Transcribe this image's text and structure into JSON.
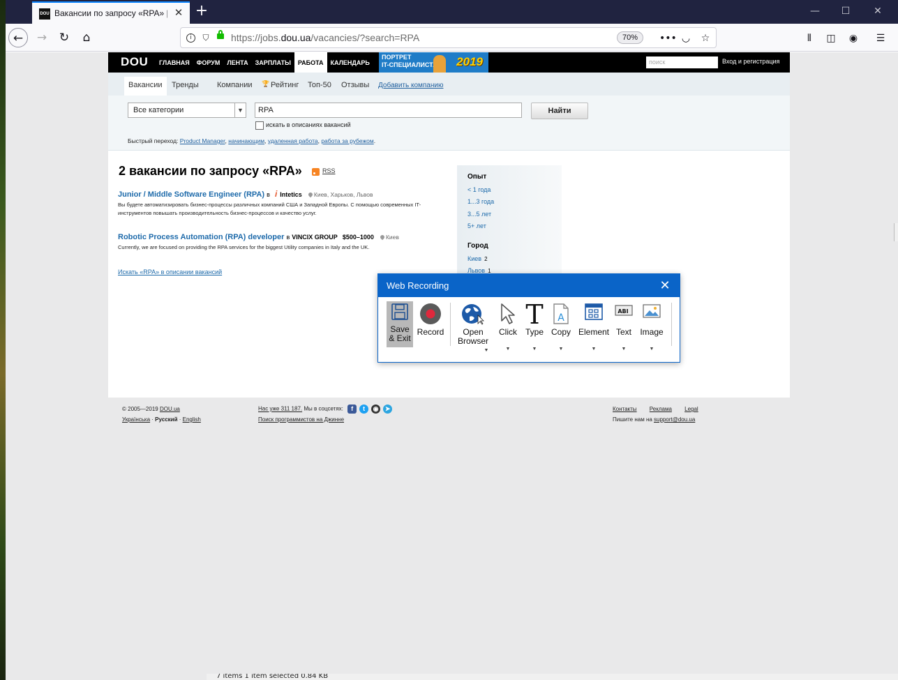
{
  "browser": {
    "tab_title": "Вакансии по запросу «RPA» | D",
    "favicon_text": "DOU",
    "url_prefix": "https://jobs.",
    "url_domain": "dou.ua",
    "url_path": "/vacancies/?search=RPA",
    "zoom": "70%"
  },
  "site": {
    "logo": "DOU",
    "nav": [
      "ГЛАВНАЯ",
      "ФОРУМ",
      "ЛЕНТА",
      "ЗАРПЛАТЫ",
      "РАБОТА",
      "КАЛЕНДАРЬ"
    ],
    "banner_text_line1": "ПОРТРЕТ",
    "banner_text_line2": "IT-СПЕЦИАЛИСТА",
    "banner_year": "2019",
    "search_placeholder": "поиск",
    "login": "Вход и регистрация"
  },
  "subnav": {
    "vacancies": "Вакансии",
    "trends": "Тренды",
    "companies": "Компании",
    "rating": "Рейтинг",
    "top50": "Топ-50",
    "reviews": "Отзывы",
    "add_company": "Добавить компанию"
  },
  "search": {
    "category": "Все категории",
    "query": "RPA",
    "submit": "Найти",
    "desc_checkbox": "искать в описаниях вакансий",
    "quick_label": "Быстрый переход:",
    "quick_links": [
      "Product Manager",
      "начинающим",
      "удаленная работа",
      "работа за рубежом"
    ]
  },
  "results": {
    "title": "2 вакансии по запросу «RPA»",
    "rss": "RSS",
    "vacancies": [
      {
        "title": "Junior / Middle Software Engineer (RPA)",
        "in": "в",
        "company": "Intetics",
        "salary": "",
        "cities": "Киев, Харьков, Львов",
        "description": "Вы будете автоматизировать бизнес-процессы различных компаний США и Западной Европы. С помощью современных IT-инструментов повышать производительность бизнес-процессов и качество услуг."
      },
      {
        "title": "Robotic Process Automation (RPA) developer",
        "in": "в",
        "company": "VINCIX GROUP",
        "salary": "$500–1000",
        "cities": "Киев",
        "description": "Currently, we are focused on providing the RPA services for the biggest Utility companies in Italy and the UK."
      }
    ],
    "search_in_desc": "Искать «RPA» в описании вакансий"
  },
  "filters": {
    "experience_title": "Опыт",
    "experience": [
      "< 1 года",
      "1...3 года",
      "3...5 лет",
      "5+ лет"
    ],
    "city_title": "Город",
    "cities": [
      {
        "name": "Киев",
        "count": "2"
      },
      {
        "name": "Львов",
        "count": "1"
      }
    ]
  },
  "footer": {
    "copyright": "© 2005—2019 ",
    "copyright_link": "DOU.ua",
    "lang_ua": "Українська",
    "lang_ru": "Русский",
    "lang_en": "English",
    "followers": "Нас уже 311 187.",
    "social_text": " Мы в соцсетях:",
    "djinni": "Поиск программистов на Джинне",
    "contacts": "Контакты",
    "ads": "Реклама",
    "legal": "Legal",
    "write_us": "Пишите нам на ",
    "email": "support@dou.ua"
  },
  "dialog": {
    "title": "Web Recording",
    "buttons": {
      "save_exit": "Save & Exit",
      "record": "Record",
      "open_browser": "Open Browser",
      "click": "Click",
      "type": "Type",
      "copy": "Copy",
      "element": "Element",
      "text": "Text",
      "image": "Image"
    }
  },
  "taskbar_fragment": "7 items    1 item selected  0.84 KB",
  "colors": {
    "accent": "#0a64c8",
    "link": "#1d6aaa",
    "tab_indicator": "#0a84ff",
    "record_red": "#e0283c"
  }
}
